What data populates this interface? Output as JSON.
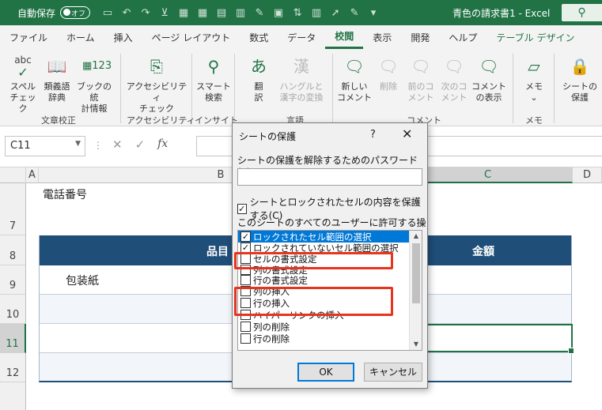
{
  "titlebar": {
    "autosave_label": "自動保存",
    "autosave_state": "オフ",
    "document_title": "青色の請求書1 - Excel",
    "search_icon": "search-icon"
  },
  "tabs": [
    "ファイル",
    "ホーム",
    "挿入",
    "ページ レイアウト",
    "数式",
    "データ",
    "校閲",
    "表示",
    "開発",
    "ヘルプ",
    "テーブル デザイン"
  ],
  "active_tab": "校閲",
  "ribbon": {
    "buttons": [
      {
        "label1": "スペル",
        "label2": "チェック",
        "icon": "abc"
      },
      {
        "label1": "類義語",
        "label2": "辞典",
        "icon": "book"
      },
      {
        "label1": "ブックの統",
        "label2": "計情報",
        "icon": "123"
      },
      {
        "label1": "アクセシビリティ",
        "label2": "チェック",
        "icon": "accessibility"
      },
      {
        "label1": "スマート",
        "label2": "検索",
        "icon": "search"
      },
      {
        "label1": "翻",
        "label2": "訳",
        "icon": "translate"
      },
      {
        "label1": "ハングルと",
        "label2": "漢字の変換",
        "icon": "漢"
      },
      {
        "label1": "新しい",
        "label2": "コメント",
        "icon": "comment-new"
      },
      {
        "label1": "削除",
        "label2": "",
        "icon": "comment-delete"
      },
      {
        "label1": "前のコ",
        "label2": "メント",
        "icon": "comment-prev"
      },
      {
        "label1": "次のコ",
        "label2": "メント",
        "icon": "comment-next"
      },
      {
        "label1": "コメント",
        "label2": "の表示",
        "icon": "comment-show"
      },
      {
        "label1": "メモ",
        "label2": "",
        "icon": "memo"
      },
      {
        "label1": "シートの",
        "label2": "保護",
        "icon": "lock"
      }
    ],
    "groups": [
      "文章校正",
      "アクセシビリティ",
      "インサイト",
      "言語",
      "コメント",
      "メモ"
    ]
  },
  "formula_bar": {
    "name_box": "C11",
    "fx": "fx"
  },
  "columns": [
    "A",
    "B",
    "C",
    "D"
  ],
  "rows": [
    "7",
    "8",
    "9",
    "10",
    "11",
    "12"
  ],
  "sheet": {
    "phone_label": "電話番号",
    "header_item": "品目",
    "header_amount": "金額",
    "row9_item": "包装紙"
  },
  "dialog": {
    "title": "シートの保護",
    "help": "?",
    "close": "✕",
    "password_label": "シートの保護を解除するためのパスワード(P)",
    "protect_label": "シートとロックされたセルの内容を保護する(C)",
    "protect_checked": true,
    "allow_label": "このシートのすべてのユーザーに許可する操作(O):",
    "permissions": [
      {
        "label": "ロックされたセル範囲の選択",
        "checked": true
      },
      {
        "label": "ロックされていないセル範囲の選択",
        "checked": true
      },
      {
        "label": "セルの書式設定",
        "checked": false
      },
      {
        "label": "列の書式設定",
        "checked": false
      },
      {
        "label": "行の書式設定",
        "checked": false
      },
      {
        "label": "列の挿入",
        "checked": false
      },
      {
        "label": "行の挿入",
        "checked": false
      },
      {
        "label": "ハイパーリンクの挿入",
        "checked": false
      },
      {
        "label": "列の削除",
        "checked": false
      },
      {
        "label": "行の削除",
        "checked": false
      }
    ],
    "ok": "OK",
    "cancel": "キャンセル"
  },
  "colors": {
    "excel_green": "#217346",
    "table_header": "#1f4e79",
    "highlight_red": "#e8341c",
    "selection_blue": "#0078d7"
  }
}
